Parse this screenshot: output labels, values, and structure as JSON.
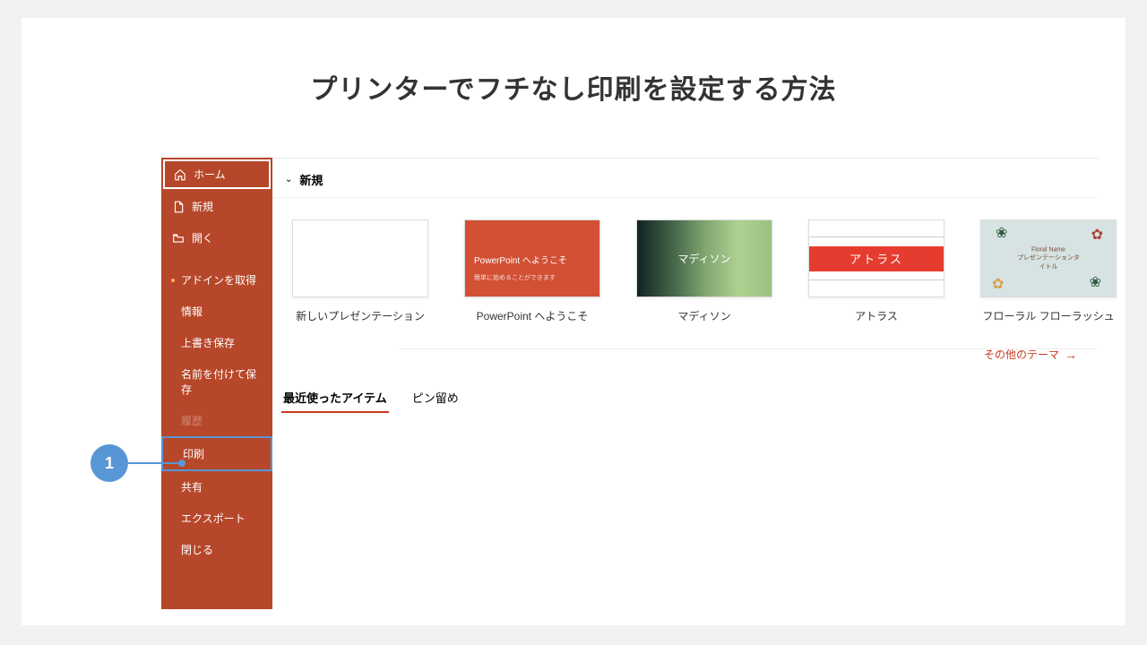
{
  "title": "プリンターでフチなし印刷を設定する方法",
  "callout": {
    "number": "1"
  },
  "sidebar": {
    "home": "ホーム",
    "new": "新規",
    "open": "開く",
    "get_addins": "アドインを取得",
    "info": "情報",
    "save": "上書き保存",
    "save_as": "名前を付けて保存",
    "history": "履歴",
    "print": "印刷",
    "share": "共有",
    "export": "エクスポート",
    "close": "閉じる"
  },
  "main": {
    "section_new": "新規",
    "more_themes": "その他のテーマ",
    "tabs": {
      "recent": "最近使ったアイテム",
      "pinned": "ピン留め"
    }
  },
  "templates": {
    "blank": "新しいプレゼンテーション",
    "welcome": "PowerPoint へようこそ",
    "welcome_line1": "PowerPoint へようこそ",
    "welcome_line2": "簡単に始めることができます",
    "madison": "マディソン",
    "madison_thumb": "マディソン",
    "atlas": "アトラス",
    "atlas_thumb": "アトラス",
    "floral": "フローラル フローラッシュ",
    "floral_line1": "Floral Name",
    "floral_line2": "プレゼンテーションタイトル"
  }
}
